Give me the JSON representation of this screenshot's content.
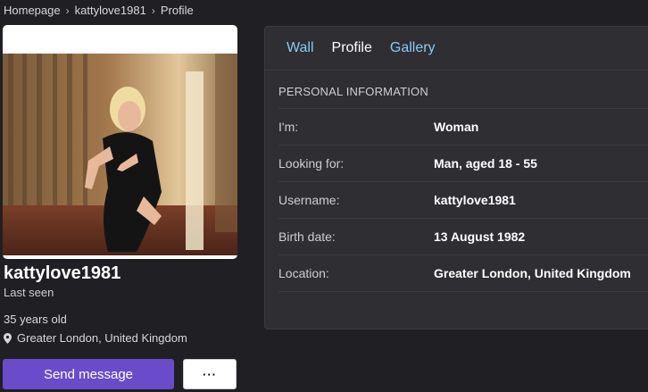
{
  "breadcrumb": {
    "home": "Homepage",
    "user": "kattylove1981",
    "current": "Profile"
  },
  "profile": {
    "username": "kattylove1981",
    "last_seen": "Last seen",
    "age": "35 years old",
    "location": "Greater London, United Kingdom"
  },
  "actions": {
    "send_message": "Send message",
    "more": "···"
  },
  "tabs": [
    {
      "label": "Wall"
    },
    {
      "label": "Profile"
    },
    {
      "label": "Gallery"
    }
  ],
  "info": {
    "section_title": "PERSONAL INFORMATION",
    "rows": [
      {
        "label": "I'm:",
        "value": "Woman"
      },
      {
        "label": "Looking for:",
        "value": "Man, aged 18 - 55"
      },
      {
        "label": "Username:",
        "value": "kattylove1981"
      },
      {
        "label": "Birth date:",
        "value": "13 August 1982"
      },
      {
        "label": "Location:",
        "value": "Greater London, United Kingdom"
      }
    ]
  },
  "colors": {
    "background": "#201f24",
    "panel": "#2e2e33",
    "accent_button": "#6a4bc9",
    "tab_link": "#8ec9f0"
  },
  "icons": {
    "location": "map-pin-icon"
  }
}
